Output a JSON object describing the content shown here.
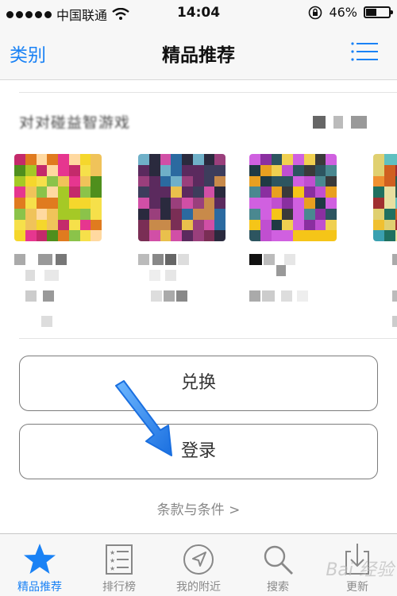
{
  "status_bar": {
    "carrier": "中国联通",
    "time": "14:04",
    "battery": "46%"
  },
  "nav": {
    "left": "类别",
    "title": "精品推荐",
    "menu_icon": "list-icon"
  },
  "section": {
    "title": "对对碰益智游戏"
  },
  "buttons": {
    "redeem": "兑换",
    "login": "登录"
  },
  "terms": "条款与条件 >",
  "tabs": [
    {
      "label": "精品推荐",
      "icon": "star-icon",
      "active": true
    },
    {
      "label": "排行榜",
      "icon": "ranking-list-icon",
      "active": false
    },
    {
      "label": "我的附近",
      "icon": "location-arrow-icon",
      "active": false
    },
    {
      "label": "搜索",
      "icon": "search-icon",
      "active": false
    },
    {
      "label": "更新",
      "icon": "download-icon",
      "active": false
    }
  ],
  "watermark": "Bai 经验",
  "colors": {
    "accent": "#1a82f5",
    "annotation_arrow": "#2f8ff5"
  }
}
